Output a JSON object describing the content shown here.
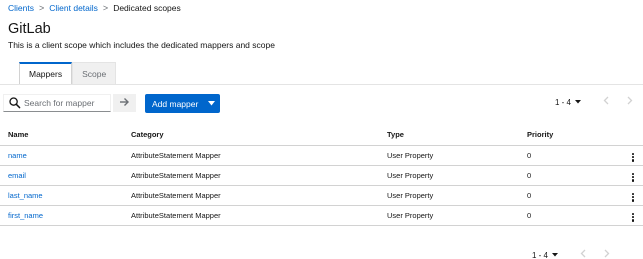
{
  "breadcrumb": {
    "items": [
      "Clients",
      "Client details"
    ],
    "current": "Dedicated scopes",
    "separator": ">"
  },
  "page": {
    "title": "GitLab",
    "description": "This is a client scope which includes the dedicated mappers and scope"
  },
  "tabs": [
    {
      "label": "Mappers",
      "active": true
    },
    {
      "label": "Scope",
      "active": false
    }
  ],
  "toolbar": {
    "search_placeholder": "Search for mapper",
    "search_value": "",
    "add_button_label": "Add mapper",
    "pagination_label": "1 - 4"
  },
  "table": {
    "headers": [
      "Name",
      "Category",
      "Type",
      "Priority"
    ],
    "rows": [
      {
        "name": "name",
        "category": "AttributeStatement Mapper",
        "type": "User Property",
        "priority": "0"
      },
      {
        "name": "email",
        "category": "AttributeStatement Mapper",
        "type": "User Property",
        "priority": "0"
      },
      {
        "name": "last_name",
        "category": "AttributeStatement Mapper",
        "type": "User Property",
        "priority": "0"
      },
      {
        "name": "first_name",
        "category": "AttributeStatement Mapper",
        "type": "User Property",
        "priority": "0"
      }
    ]
  },
  "footer": {
    "pagination_label": "1 - 4"
  },
  "icons": {
    "search": "search-icon",
    "arrow": "arrow-right-icon",
    "caret": "caret-down-icon",
    "kebab": "kebab-icon",
    "prev": "chevron-left-icon",
    "next": "chevron-right-icon"
  },
  "colors": {
    "link": "#0066cc",
    "primary": "#0066cc",
    "disabled": "#d2d2d2"
  }
}
